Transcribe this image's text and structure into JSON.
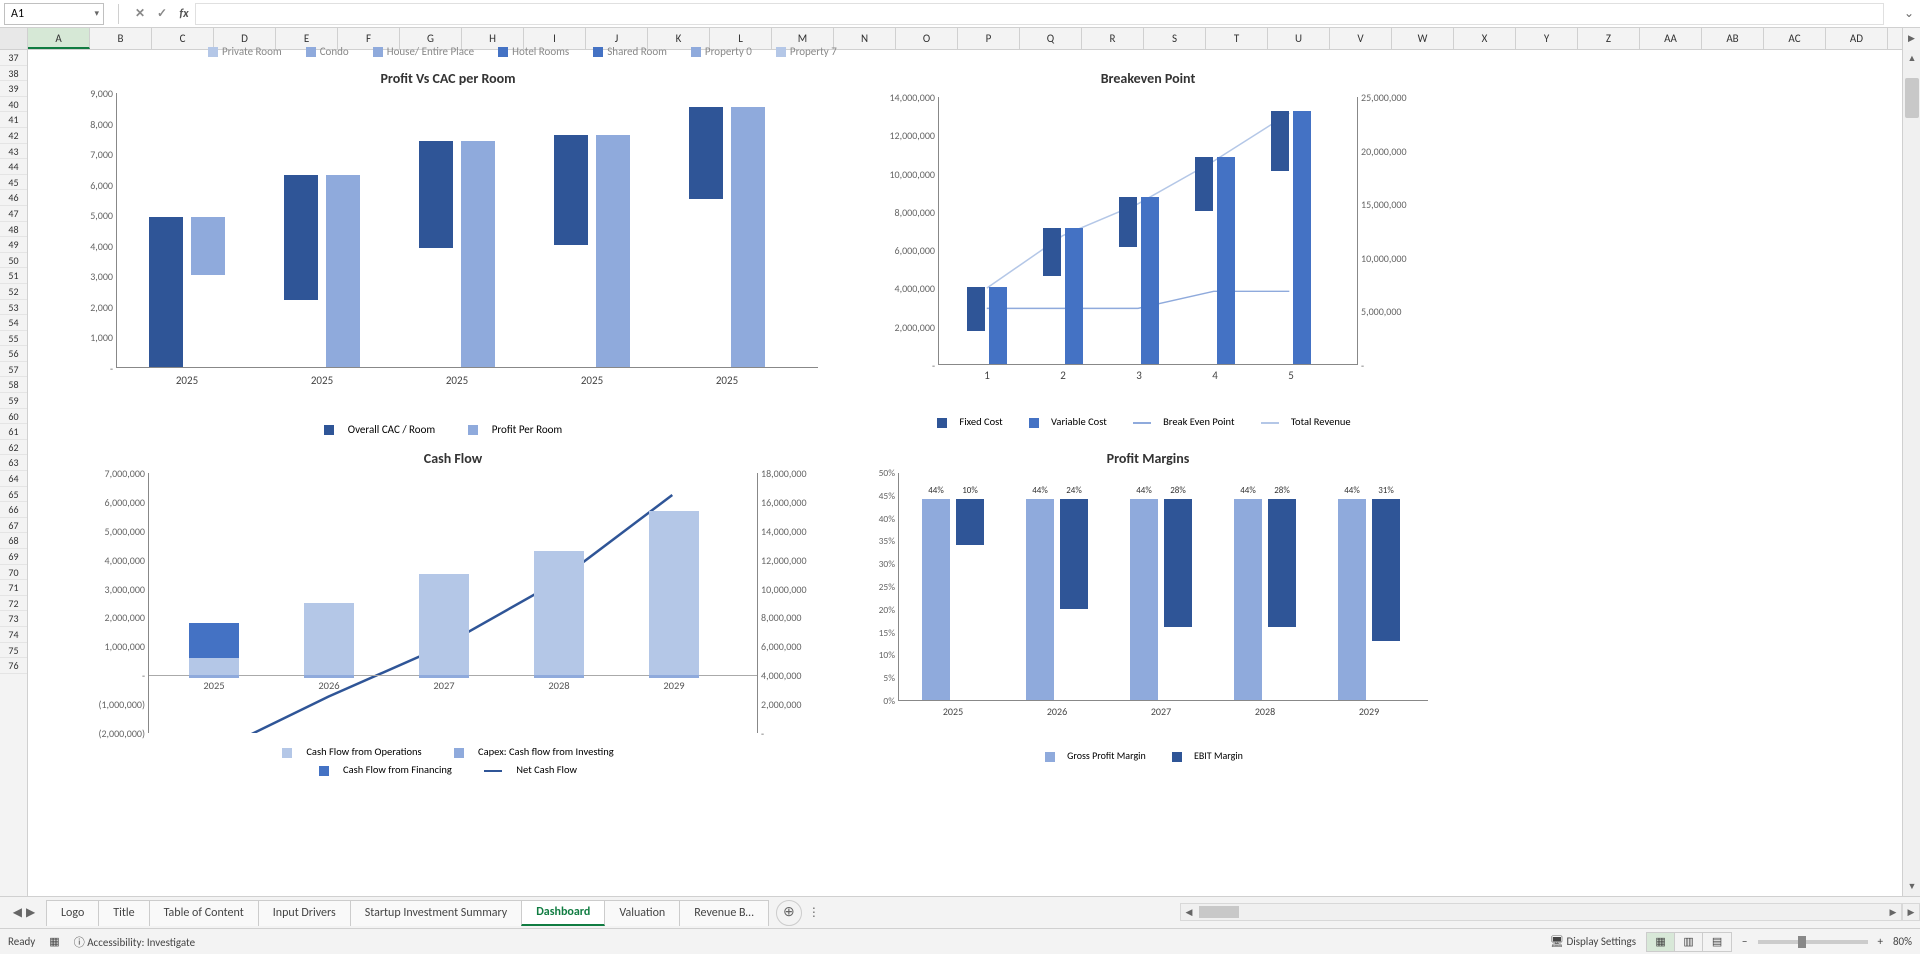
{
  "cell_ref": "A1",
  "columns": [
    "A",
    "B",
    "C",
    "D",
    "E",
    "F",
    "G",
    "H",
    "I",
    "J",
    "K",
    "L",
    "M",
    "N",
    "O",
    "P",
    "Q",
    "R",
    "S",
    "T",
    "U",
    "V",
    "W",
    "X",
    "Y",
    "Z",
    "AA",
    "AB",
    "AC",
    "AD"
  ],
  "rows_start": 37,
  "rows_end": 76,
  "top_legend": [
    "Private Room",
    "Condo",
    "House/ Entire Place",
    "Hotel Rooms",
    "Shared Room",
    "Property 0",
    "Property 7"
  ],
  "tabs": [
    "Logo",
    "Title",
    "Table of Content",
    "Input Drivers",
    "Startup Investment Summary",
    "Dashboard",
    "Valuation",
    "Revenue B…"
  ],
  "active_tab": "Dashboard",
  "status": {
    "ready": "Ready",
    "accessibility": "Accessibility: Investigate",
    "display": "Display Settings",
    "zoom": "80%",
    "zoom_minus": "−",
    "zoom_plus": "+"
  },
  "chart1": {
    "title": "Profit Vs CAC per Room",
    "axis": [
      "-",
      "1,000",
      "2,000",
      "3,000",
      "4,000",
      "5,000",
      "6,000",
      "7,000",
      "8,000",
      "9,000"
    ],
    "cats": [
      "2025",
      "2025",
      "2025",
      "2025",
      "2025"
    ],
    "legend": [
      "Overall CAC / Room",
      "Profit Per Room"
    ]
  },
  "chart2": {
    "title": "Breakeven Point",
    "yl": [
      "-",
      "2,000,000",
      "4,000,000",
      "6,000,000",
      "8,000,000",
      "10,000,000",
      "12,000,000",
      "14,000,000"
    ],
    "yr": [
      "-",
      "5,000,000",
      "10,000,000",
      "15,000,000",
      "20,000,000",
      "25,000,000"
    ],
    "cats": [
      "1",
      "2",
      "3",
      "4",
      "5"
    ],
    "legend": [
      "Fixed Cost",
      "Variable Cost",
      "Break Even Point",
      "Total Revenue"
    ]
  },
  "chart3": {
    "title": "Cash Flow",
    "yl": [
      "(2,000,000)",
      "(1,000,000)",
      "-",
      "1,000,000",
      "2,000,000",
      "3,000,000",
      "4,000,000",
      "5,000,000",
      "6,000,000",
      "7,000,000"
    ],
    "yr": [
      "-",
      "2,000,000",
      "4,000,000",
      "6,000,000",
      "8,000,000",
      "10,000,000",
      "12,000,000",
      "14,000,000",
      "16,000,000",
      "18,000,000"
    ],
    "cats": [
      "2025",
      "2026",
      "2027",
      "2028",
      "2029"
    ],
    "legend": [
      "Cash Flow from Operations",
      "Capex: Cash flow from Investing",
      "Cash Flow from Financing",
      "Net Cash Flow"
    ]
  },
  "chart4": {
    "title": "Profit Margins",
    "yl": [
      "0%",
      "5%",
      "10%",
      "15%",
      "20%",
      "25%",
      "30%",
      "35%",
      "40%",
      "45%",
      "50%"
    ],
    "cats": [
      "2025",
      "2026",
      "2027",
      "2028",
      "2029"
    ],
    "gross": [
      "44%",
      "44%",
      "44%",
      "44%",
      "44%"
    ],
    "ebit": [
      "10%",
      "24%",
      "28%",
      "28%",
      "31%"
    ],
    "legend": [
      "Gross Profit Margin",
      "EBIT Margin"
    ]
  },
  "chart_data": [
    {
      "type": "bar",
      "title": "Profit Vs CAC per Room",
      "categories": [
        "2025",
        "2025",
        "2025",
        "2025",
        "2025"
      ],
      "series": [
        {
          "name": "Overall CAC / Room",
          "values": [
            4900,
            4100,
            3500,
            3600,
            3000
          ]
        },
        {
          "name": "Profit Per Room",
          "values": [
            1900,
            6300,
            7400,
            7600,
            8500
          ]
        }
      ],
      "ylim": [
        0,
        9000
      ]
    },
    {
      "type": "bar-line",
      "title": "Breakeven Point",
      "categories": [
        "1",
        "2",
        "3",
        "4",
        "5"
      ],
      "series": [
        {
          "name": "Fixed Cost",
          "axis": "left",
          "values": [
            2300000,
            2500000,
            2600000,
            2800000,
            3100000
          ]
        },
        {
          "name": "Variable Cost",
          "axis": "left",
          "values": [
            4000000,
            7100000,
            8700000,
            10800000,
            13200000
          ]
        },
        {
          "name": "Break Even Point",
          "axis": "right",
          "type": "line",
          "values": [
            5200000,
            5200000,
            5200000,
            6800000,
            6800000
          ]
        },
        {
          "name": "Total Revenue",
          "axis": "right",
          "type": "line",
          "values": [
            7100000,
            12000000,
            15000000,
            19000000,
            23500000
          ]
        }
      ],
      "ylim_left": [
        0,
        14000000
      ],
      "ylim_right": [
        0,
        25000000
      ]
    },
    {
      "type": "stacked-bar-line",
      "title": "Cash Flow",
      "categories": [
        "2025",
        "2026",
        "2027",
        "2028",
        "2029"
      ],
      "series": [
        {
          "name": "Cash Flow from Operations",
          "values": [
            600000,
            2500000,
            3500000,
            4300000,
            5700000
          ]
        },
        {
          "name": "Capex: Cash flow from Investing",
          "values": [
            -100000,
            -100000,
            -100000,
            -100000,
            -100000
          ]
        },
        {
          "name": "Cash Flow from Financing",
          "values": [
            1200000,
            0,
            0,
            0,
            0
          ]
        },
        {
          "name": "Net Cash Flow",
          "axis": "right",
          "type": "line",
          "values": [
            -1500000,
            2500000,
            6000000,
            10500000,
            16500000
          ]
        }
      ],
      "ylim_left": [
        -2000000,
        7000000
      ],
      "ylim_right": [
        0,
        18000000
      ]
    },
    {
      "type": "bar",
      "title": "Profit Margins",
      "categories": [
        "2025",
        "2026",
        "2027",
        "2028",
        "2029"
      ],
      "series": [
        {
          "name": "Gross Profit Margin",
          "values": [
            44,
            44,
            44,
            44,
            44
          ]
        },
        {
          "name": "EBIT Margin",
          "values": [
            10,
            24,
            28,
            28,
            31
          ]
        }
      ],
      "ylabel": "%",
      "ylim": [
        0,
        50
      ]
    }
  ]
}
